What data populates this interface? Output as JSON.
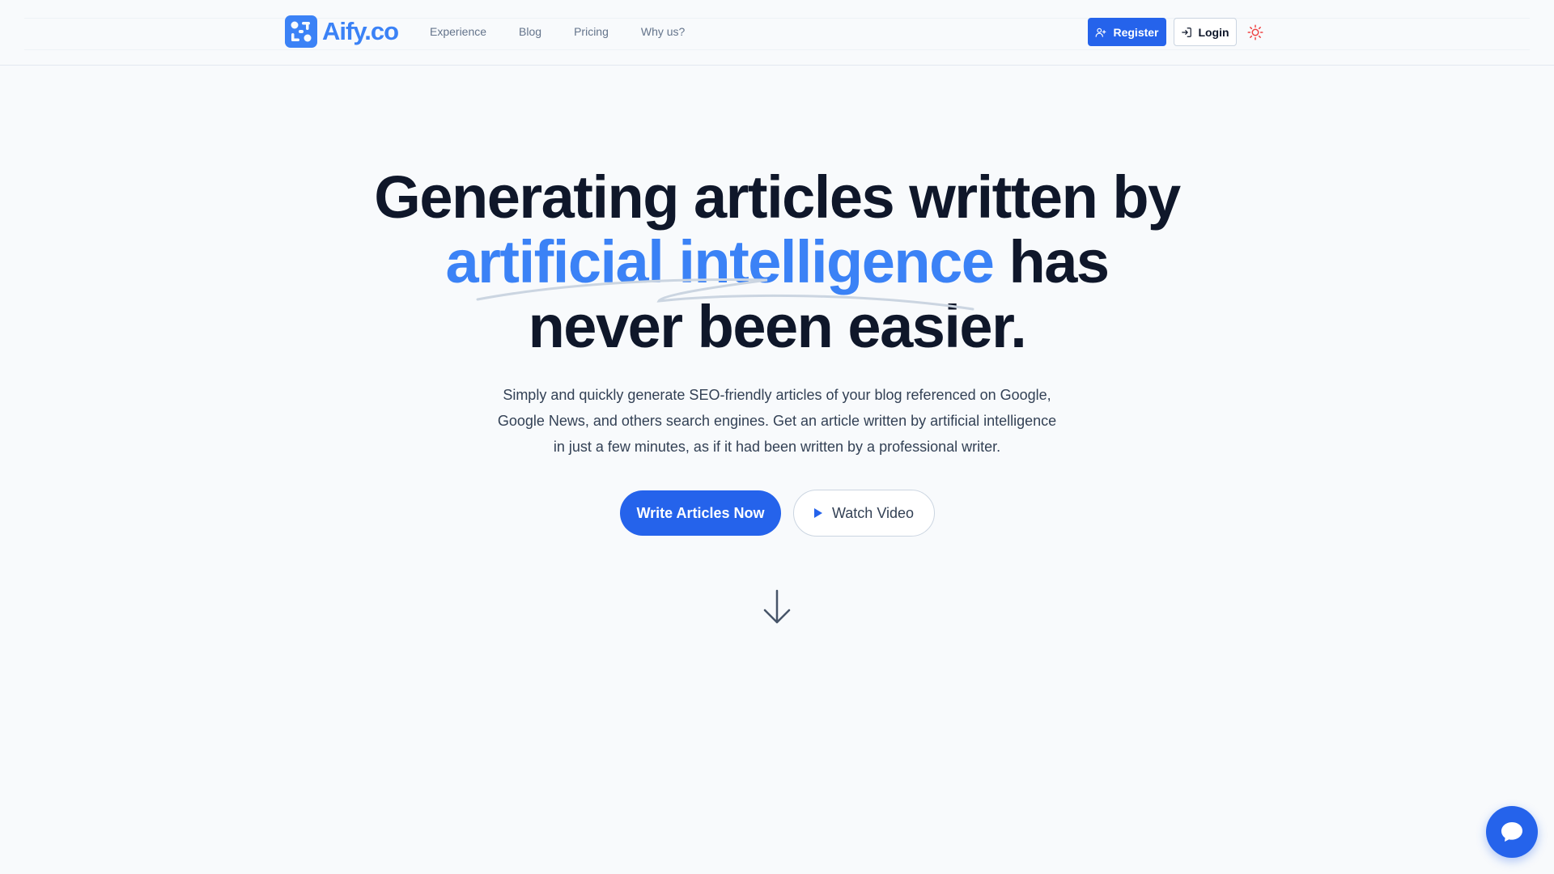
{
  "header": {
    "brand": "Aify.co",
    "nav": [
      {
        "label": "Experience"
      },
      {
        "label": "Blog"
      },
      {
        "label": "Pricing"
      },
      {
        "label": "Why us?"
      }
    ],
    "register_label": "Register",
    "login_label": "Login"
  },
  "hero": {
    "title_line1": "Generating articles written by",
    "title_accent": "artificial intelligence",
    "title_line2_rest": " has",
    "title_line3": "never been easier.",
    "subtitle": "Simply and quickly generate SEO-friendly articles of your blog referenced on Google, Google News, and others search engines. Get an article written by artificial intelligence in just a few minutes, as if it had been written by a professional writer.",
    "primary_cta": "Write Articles Now",
    "secondary_cta": "Watch Video"
  },
  "colors": {
    "primary": "#2563eb",
    "accent": "#3b82f6",
    "heading": "#0f172a",
    "background": "#f8fafc"
  },
  "icons": {
    "logo": "aify-logo-icon",
    "register": "user-plus-icon",
    "login": "login-icon",
    "theme": "sun-icon",
    "play": "play-icon",
    "scroll": "arrow-down-icon",
    "chat": "chat-bubble-icon"
  }
}
